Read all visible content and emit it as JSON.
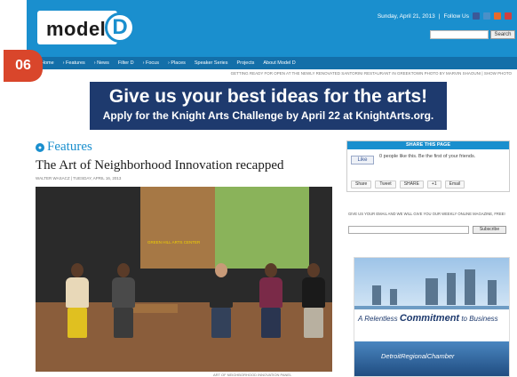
{
  "header": {
    "logo_text": "model",
    "logo_letter": "D",
    "date": "Sunday, April 21, 2013",
    "follow_label": "Follow Us",
    "search_button": "Search"
  },
  "nav": {
    "items": [
      "Home",
      "Features",
      "News",
      "Filter D",
      "Focus",
      "Places",
      "Speaker Series",
      "Projects",
      "About Model D"
    ]
  },
  "top_caption": "GETTING READY FOR OPEN AT THE NEWLY RENOVATED SANTORINI RESTAURANT IN GREEKTOWN PHOTO BY MARVIN SHAOUNI | SHOW PHOTO",
  "banner": {
    "headline": "Give us your best ideas for the arts!",
    "subline": "Apply for the Knight Arts Challenge by April 22 at KnightArts.org."
  },
  "main": {
    "section_title": "Features",
    "article_title": "The Art of Neighborhood Innovation recapped",
    "byline": "WALTER WASACZ | TUESDAY, APRIL 16, 2013",
    "photo_screen_text": "GREEN HILL ARTS CENTER",
    "photo_caption": "ART OF NEIGHBORHOOD INNOVATION PANEL"
  },
  "share": {
    "header": "SHARE THIS PAGE",
    "like_label": "Like",
    "like_text": "0 people like this. Be the first of your friends.",
    "buttons": [
      "Share",
      "Tweet",
      "SHARE",
      "+1",
      "Email"
    ]
  },
  "signup": {
    "text": "GIVE US YOUR EMAIL AND WE WILL GIVE YOU OUR WEEKLY ONLINE MAGAZINE, FREE!",
    "button": "Subscribe"
  },
  "side_ad": {
    "line1": "A Relentless",
    "line2": "Commitment",
    "line3": "to Business",
    "logo": "DetroitRegionalChamber"
  },
  "badge": "06",
  "colors": {
    "brand_blue": "#1a8fce",
    "nav_blue": "#136fa9",
    "banner_navy": "#1e3a6e",
    "badge_red": "#d9462b"
  }
}
